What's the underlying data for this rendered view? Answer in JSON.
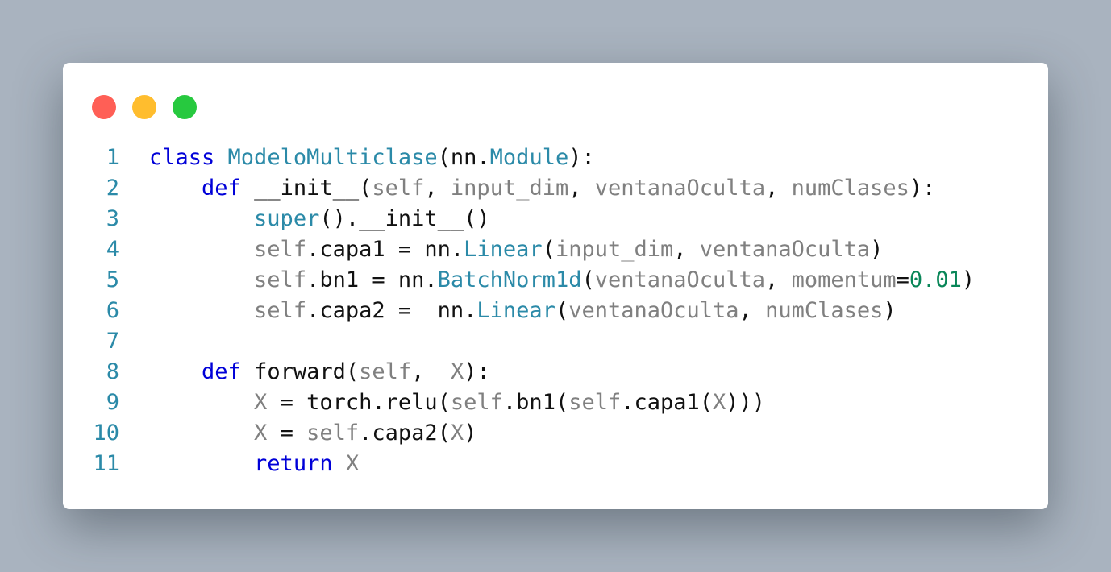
{
  "window_controls": {
    "close_color": "#ff5f56",
    "minimize_color": "#ffbd2e",
    "maximize_color": "#27c93f"
  },
  "code": {
    "lines": [
      {
        "n": "1",
        "tokens": [
          {
            "t": "class",
            "c": "kw"
          },
          {
            "t": " ",
            "c": "plain"
          },
          {
            "t": "ModeloMulticlase",
            "c": "cls"
          },
          {
            "t": "(nn.",
            "c": "plain"
          },
          {
            "t": "Module",
            "c": "cls"
          },
          {
            "t": "):",
            "c": "plain"
          }
        ]
      },
      {
        "n": "2",
        "tokens": [
          {
            "t": "    ",
            "c": "plain"
          },
          {
            "t": "def",
            "c": "kw"
          },
          {
            "t": " __init__(",
            "c": "plain"
          },
          {
            "t": "self",
            "c": "param"
          },
          {
            "t": ", ",
            "c": "plain"
          },
          {
            "t": "input_dim",
            "c": "param"
          },
          {
            "t": ", ",
            "c": "plain"
          },
          {
            "t": "ventanaOculta",
            "c": "param"
          },
          {
            "t": ", ",
            "c": "plain"
          },
          {
            "t": "numClases",
            "c": "param"
          },
          {
            "t": "):",
            "c": "plain"
          }
        ]
      },
      {
        "n": "3",
        "tokens": [
          {
            "t": "        ",
            "c": "plain"
          },
          {
            "t": "super",
            "c": "cls"
          },
          {
            "t": "().__init__()",
            "c": "plain"
          }
        ]
      },
      {
        "n": "4",
        "tokens": [
          {
            "t": "        ",
            "c": "plain"
          },
          {
            "t": "self",
            "c": "param"
          },
          {
            "t": ".capa1 = nn.",
            "c": "plain"
          },
          {
            "t": "Linear",
            "c": "cls"
          },
          {
            "t": "(",
            "c": "plain"
          },
          {
            "t": "input_dim",
            "c": "param"
          },
          {
            "t": ", ",
            "c": "plain"
          },
          {
            "t": "ventanaOculta",
            "c": "param"
          },
          {
            "t": ")",
            "c": "plain"
          }
        ]
      },
      {
        "n": "5",
        "tokens": [
          {
            "t": "        ",
            "c": "plain"
          },
          {
            "t": "self",
            "c": "param"
          },
          {
            "t": ".bn1 = nn.",
            "c": "plain"
          },
          {
            "t": "BatchNorm1d",
            "c": "cls"
          },
          {
            "t": "(",
            "c": "plain"
          },
          {
            "t": "ventanaOculta",
            "c": "param"
          },
          {
            "t": ", ",
            "c": "plain"
          },
          {
            "t": "momentum",
            "c": "param"
          },
          {
            "t": "=",
            "c": "plain"
          },
          {
            "t": "0.01",
            "c": "num"
          },
          {
            "t": ")",
            "c": "plain"
          }
        ]
      },
      {
        "n": "6",
        "tokens": [
          {
            "t": "        ",
            "c": "plain"
          },
          {
            "t": "self",
            "c": "param"
          },
          {
            "t": ".capa2 =  nn.",
            "c": "plain"
          },
          {
            "t": "Linear",
            "c": "cls"
          },
          {
            "t": "(",
            "c": "plain"
          },
          {
            "t": "ventanaOculta",
            "c": "param"
          },
          {
            "t": ", ",
            "c": "plain"
          },
          {
            "t": "numClases",
            "c": "param"
          },
          {
            "t": ")",
            "c": "plain"
          }
        ]
      },
      {
        "n": "7",
        "tokens": []
      },
      {
        "n": "8",
        "tokens": [
          {
            "t": "    ",
            "c": "plain"
          },
          {
            "t": "def",
            "c": "kw"
          },
          {
            "t": " forward(",
            "c": "plain"
          },
          {
            "t": "self",
            "c": "param"
          },
          {
            "t": ",  ",
            "c": "plain"
          },
          {
            "t": "X",
            "c": "param"
          },
          {
            "t": "):",
            "c": "plain"
          }
        ]
      },
      {
        "n": "9",
        "tokens": [
          {
            "t": "        ",
            "c": "plain"
          },
          {
            "t": "X",
            "c": "param"
          },
          {
            "t": " = torch.relu(",
            "c": "plain"
          },
          {
            "t": "self",
            "c": "param"
          },
          {
            "t": ".bn1(",
            "c": "plain"
          },
          {
            "t": "self",
            "c": "param"
          },
          {
            "t": ".capa1(",
            "c": "plain"
          },
          {
            "t": "X",
            "c": "param"
          },
          {
            "t": ")))",
            "c": "plain"
          }
        ]
      },
      {
        "n": "10",
        "tokens": [
          {
            "t": "        ",
            "c": "plain"
          },
          {
            "t": "X",
            "c": "param"
          },
          {
            "t": " = ",
            "c": "plain"
          },
          {
            "t": "self",
            "c": "param"
          },
          {
            "t": ".capa2(",
            "c": "plain"
          },
          {
            "t": "X",
            "c": "param"
          },
          {
            "t": ")",
            "c": "plain"
          }
        ]
      },
      {
        "n": "11",
        "tokens": [
          {
            "t": "        ",
            "c": "plain"
          },
          {
            "t": "return",
            "c": "kw"
          },
          {
            "t": " ",
            "c": "plain"
          },
          {
            "t": "X",
            "c": "param"
          }
        ]
      }
    ]
  }
}
